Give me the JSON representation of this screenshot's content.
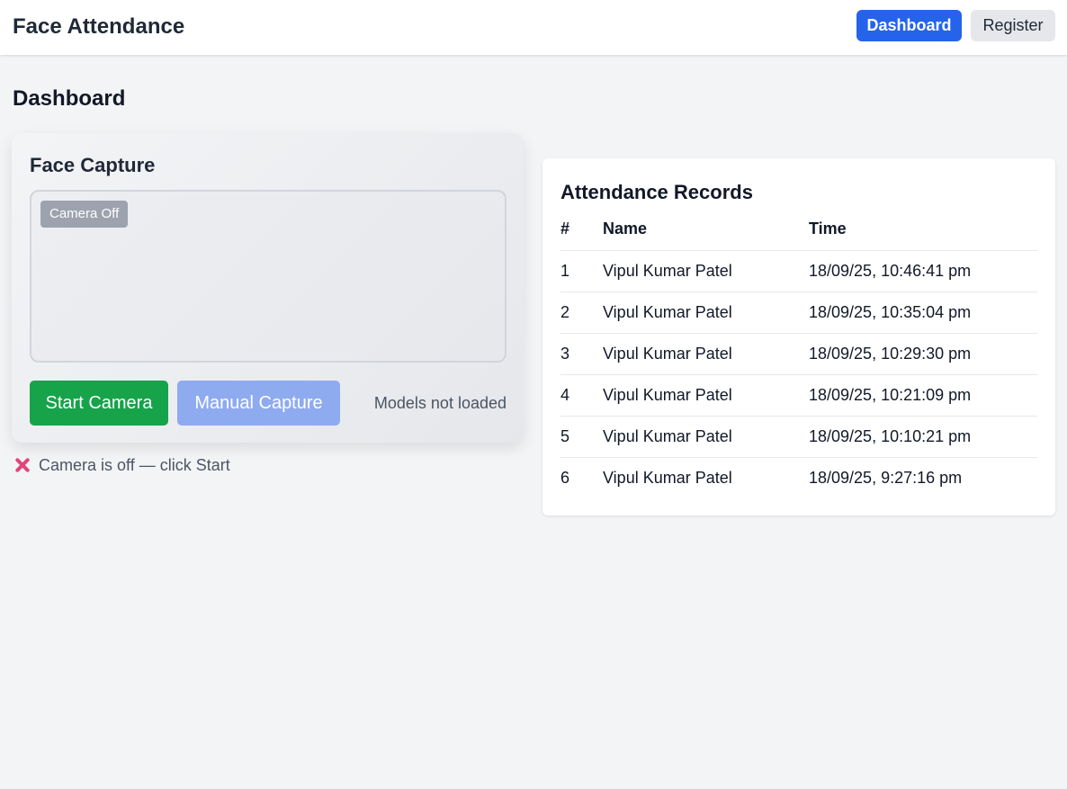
{
  "header": {
    "app_title": "Face Attendance",
    "nav": {
      "dashboard": "Dashboard",
      "register": "Register"
    }
  },
  "page": {
    "title": "Dashboard"
  },
  "capture": {
    "title": "Face Capture",
    "camera_badge": "Camera Off",
    "start_button": "Start Camera",
    "manual_button": "Manual Capture",
    "models_status": "Models not loaded",
    "camera_status": "Camera is off — click Start",
    "status_icon": "x-icon"
  },
  "records": {
    "title": "Attendance Records",
    "columns": [
      "#",
      "Name",
      "Time"
    ],
    "rows": [
      [
        "1",
        "Vipul Kumar Patel",
        "18/09/25, 10:46:41 pm"
      ],
      [
        "2",
        "Vipul Kumar Patel",
        "18/09/25, 10:35:04 pm"
      ],
      [
        "3",
        "Vipul Kumar Patel",
        "18/09/25, 10:29:30 pm"
      ],
      [
        "4",
        "Vipul Kumar Patel",
        "18/09/25, 10:21:09 pm"
      ],
      [
        "5",
        "Vipul Kumar Patel",
        "18/09/25, 10:10:21 pm"
      ],
      [
        "6",
        "Vipul Kumar Patel",
        "18/09/25, 9:27:16 pm"
      ]
    ]
  },
  "colors": {
    "primary": "#2563eb",
    "success": "#16a34a",
    "disabled": "#8fabef",
    "error_icon": "#e0457b"
  }
}
